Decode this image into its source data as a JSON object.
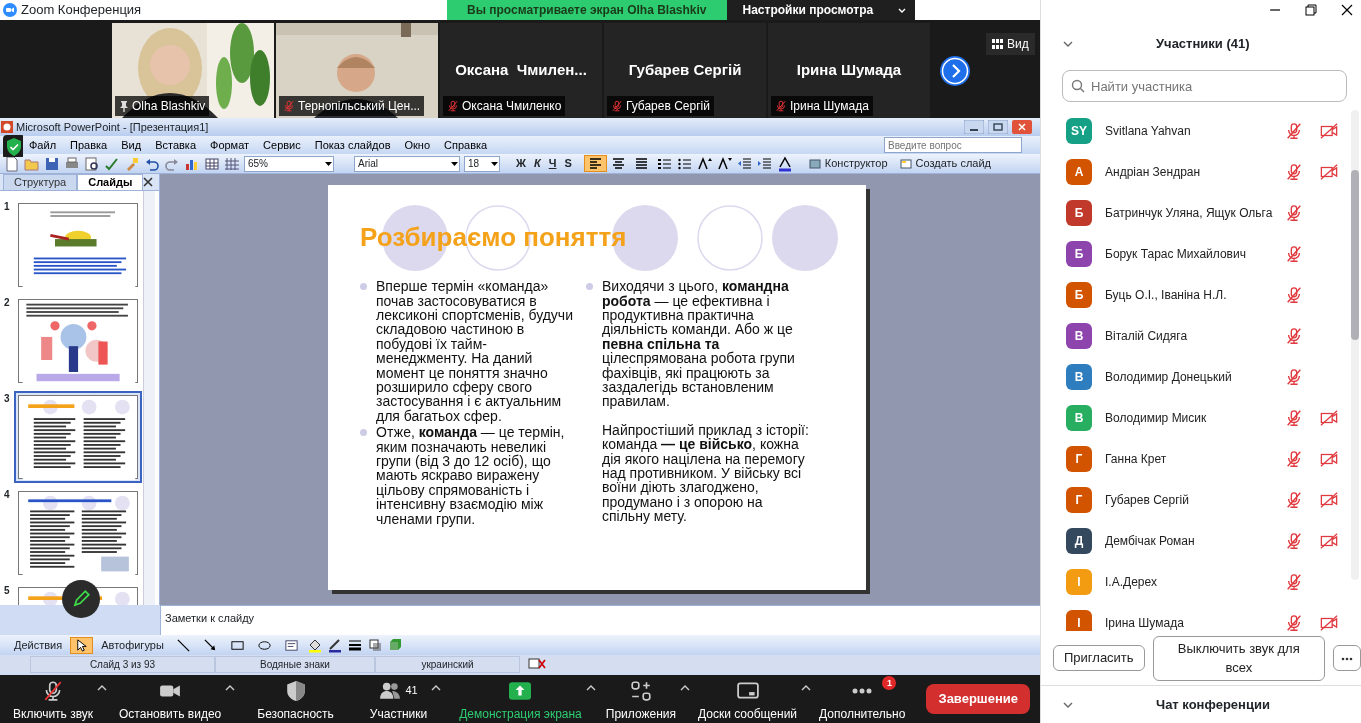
{
  "window": {
    "title": "Zoom Конференция"
  },
  "share_banner": {
    "message": "Вы просматриваете экран Olha Blashkiv",
    "settings": "Настройки просмотра"
  },
  "gallery": {
    "view_button": "Вид",
    "tiles": [
      {
        "kind": "video",
        "label": "Olha Blashkiv",
        "pinned": true,
        "muted": false
      },
      {
        "kind": "video",
        "label": "Тернопільський Цен...",
        "pinned": false,
        "muted": true
      },
      {
        "kind": "name",
        "display_name": "Оксана  Чмилен...",
        "label": "Оксана Чмиленко",
        "pinned": false,
        "muted": true
      },
      {
        "kind": "name",
        "display_name": "Губарев Сергій",
        "label": "Губарев Сергій",
        "pinned": false,
        "muted": true
      },
      {
        "kind": "name",
        "display_name": "Ірина Шумада",
        "label": "Ірина Шумада",
        "pinned": false,
        "muted": true
      }
    ]
  },
  "powerpoint": {
    "title": "Microsoft PowerPoint - [Презентация1]",
    "menu": [
      "Файл",
      "Правка",
      "Вид",
      "Вставка",
      "Формат",
      "Сервис",
      "Показ слайдов",
      "Окно",
      "Справка"
    ],
    "help_placeholder": "Введите вопрос",
    "zoom": "65%",
    "font": "Arial",
    "font_size": "18",
    "style_buttons": [
      "Ж",
      "К",
      "Ч",
      "S"
    ],
    "alignments": [
      {
        "kind": "left",
        "selected": true
      },
      {
        "kind": "center",
        "selected": false
      },
      {
        "kind": "justify",
        "selected": false
      }
    ],
    "design_button": "Конструктор",
    "new_slide_button": "Создать слайд",
    "pane_tabs": [
      {
        "label": "Структура",
        "selected": false
      },
      {
        "label": "Слайды",
        "selected": true
      }
    ],
    "thumbnails": [
      {
        "number": "1",
        "kind": "title_image",
        "selected": false
      },
      {
        "number": "2",
        "kind": "illustration",
        "selected": false
      },
      {
        "number": "3",
        "kind": "two_column",
        "selected": true
      },
      {
        "number": "4",
        "kind": "two_column_pattern",
        "selected": false
      },
      {
        "number": "5",
        "kind": "heading",
        "selected": false
      }
    ],
    "slide": {
      "title": "Розбираємо поняття",
      "columns": [
        [
          {
            "bullet": true,
            "text": "Вперше термін «команда» почав застосовуватися в лексиконі спортсменів, будучи складовою частиною в побудові їх тайм-менеджменту. На даний момент це поняття значно розширило сферу свого застосування і є актуальним для багатьох сфер."
          },
          {
            "bullet": true,
            "text": "Отже, **команда** — це термін, яким позначають невеликі групи (від 3 до 12 осіб), що мають яскраво виражену цільову спрямованість і інтенсивну взаємодію між членами групи."
          }
        ],
        [
          {
            "bullet": true,
            "text": "Виходячи з цього, **командна робота** — це ефективна і продуктивна практична діяльність команди. Або ж це **певна спільна та** цілеспрямована робота групи фахівців, які працюють за заздалегідь встановленим правилам."
          },
          {
            "bullet": false,
            "text": "Найпростіший приклад з історії: команда **— це військо**, кожна дія якого націлена на перемогу над противником. У війську всі воїни діють злагоджено, продумано і з опорою на спільну мету."
          }
        ]
      ]
    },
    "notes_placeholder": "Заметки к слайду",
    "actions_menu": "Действия",
    "autoshapes_menu": "Автофигуры",
    "drawing_tools": [
      {
        "kind": "pointer",
        "selected": true
      },
      {
        "kind": "line",
        "selected": false
      },
      {
        "kind": "arrow",
        "selected": false
      },
      {
        "kind": "rectangle",
        "selected": false
      },
      {
        "kind": "oval",
        "selected": false
      },
      {
        "kind": "textbox",
        "selected": false
      }
    ],
    "status": [
      "Слайд 3 из 93",
      "Водяные знаки",
      "украинский"
    ]
  },
  "toolbar": {
    "items": [
      {
        "kind": "audio",
        "label": "Включить звук",
        "caret": true
      },
      {
        "kind": "video",
        "label": "Остановить видео",
        "caret": true
      },
      {
        "kind": "security",
        "label": "Безопасность",
        "caret": false
      },
      {
        "kind": "participants",
        "label": "Участники",
        "count": "41",
        "caret": true
      },
      {
        "kind": "share",
        "label": "Демонстрация экрана",
        "caret": true
      },
      {
        "kind": "apps",
        "label": "Приложения",
        "caret": true
      },
      {
        "kind": "whiteboards",
        "label": "Доски сообщений",
        "caret": true
      },
      {
        "kind": "more",
        "label": "Дополнительно",
        "badge": "1",
        "caret": false
      }
    ],
    "end_button": "Завершение"
  },
  "panel": {
    "title": "Участники (41)",
    "search_placeholder": "Найти участника",
    "participants": [
      {
        "initials": "SY",
        "name": "Svitlana Yahvan",
        "color": "#16a085",
        "audio_muted": true,
        "video_off": true
      },
      {
        "initials": "А",
        "name": "Андріан Зендран",
        "color": "#d35400",
        "audio_muted": true,
        "video_off": true
      },
      {
        "initials": "Б",
        "name": "Батринчук Уляна, Ящук Ольга",
        "color": "#c0392b",
        "audio_muted": true,
        "video_off": false
      },
      {
        "initials": "Б",
        "name": "Борук Тарас Михайлович",
        "color": "#8e44ad",
        "audio_muted": true,
        "video_off": false
      },
      {
        "initials": "Б",
        "name": "Буць О.І., Іваніна Н.Л.",
        "color": "#d35400",
        "audio_muted": true,
        "video_off": false
      },
      {
        "initials": "В",
        "name": "Віталій Сидяга",
        "color": "#8e44ad",
        "audio_muted": true,
        "video_off": false
      },
      {
        "initials": "В",
        "name": "Володимир Донецький",
        "color": "#2e7dbf",
        "audio_muted": true,
        "video_off": false
      },
      {
        "initials": "В",
        "name": "Володимир Мисик",
        "color": "#27ae60",
        "audio_muted": true,
        "video_off": true
      },
      {
        "initials": "Г",
        "name": "Ганна Крет",
        "color": "#d35400",
        "audio_muted": true,
        "video_off": true
      },
      {
        "initials": "Г",
        "name": "Губарев Сергій",
        "color": "#d35400",
        "audio_muted": true,
        "video_off": true
      },
      {
        "initials": "Д",
        "name": "Дембічак Роман",
        "color": "#34495e",
        "audio_muted": true,
        "video_off": true
      },
      {
        "initials": "І",
        "name": "І.А.Дерех",
        "color": "#f39c12",
        "audio_muted": true,
        "video_off": false
      },
      {
        "initials": "І",
        "name": "Ірина Шумада",
        "color": "#d35400",
        "audio_muted": true,
        "video_off": true
      }
    ],
    "buttons": [
      "Пригласить",
      "Выключить звук для всех"
    ],
    "chat_title": "Чат конференции"
  }
}
